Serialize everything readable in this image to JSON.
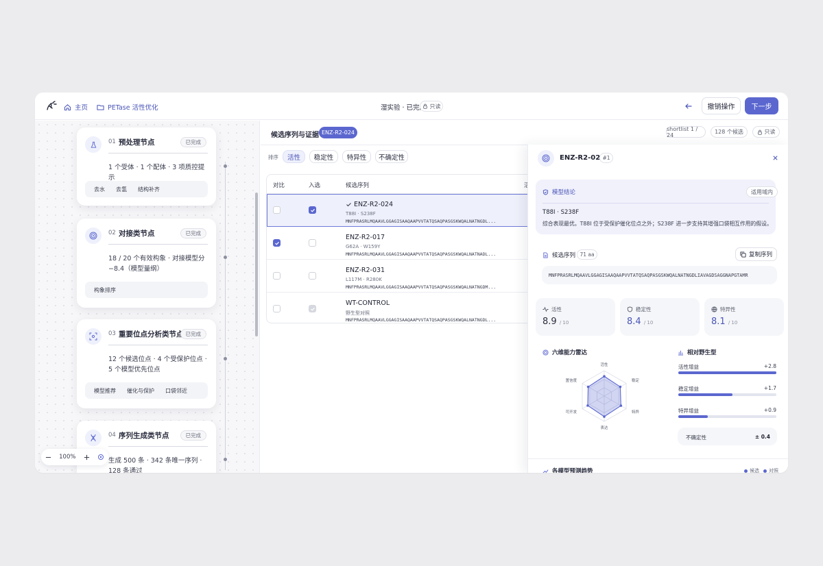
{
  "topbar": {
    "home": "主页",
    "project": "PETase 活性优化",
    "status": "湿实验 · 已完成",
    "readonly": "只读",
    "revoke": "撤销操作",
    "next": "下一步"
  },
  "nodes": [
    {
      "num": "01",
      "title": "预处理节点",
      "badge": "已完成",
      "desc": "1 个受体 · 1 个配体 · 3 项质控提示",
      "tags": [
        "去水",
        "去氢",
        "结构补齐"
      ]
    },
    {
      "num": "02",
      "title": "对接类节点",
      "badge": "已完成",
      "desc": "18 / 20 个有效构象 · 对接模型分 −8.4（模型量纲）",
      "tags": [
        "构象排序"
      ]
    },
    {
      "num": "03",
      "title": "重要位点分析类节点",
      "badge": "已完成",
      "desc": "12 个候选位点 · 4 个受保护位点 · 5 个模型优先位点",
      "tags": [
        "模型推荐",
        "催化与保护",
        "口袋邻近"
      ]
    },
    {
      "num": "04",
      "title": "序列生成类节点",
      "badge": "已完成",
      "desc": "生成 500 条 · 342 条唯一序列 · 128 条通过"
    }
  ],
  "zoom": {
    "level": "100%"
  },
  "middle": {
    "title": "候选序列与证据",
    "selected_chip": "ENZ-R2-024",
    "shortlist": "shortlist 1 / 24",
    "candidates": "128 个候选",
    "readonly": "只读",
    "sort_label": "排序",
    "sort_options": [
      "活性",
      "稳定性",
      "特异性",
      "不确定性"
    ],
    "columns": [
      "对比",
      "入选",
      "候选序列",
      "活"
    ],
    "rows": [
      {
        "id": "ENZ-R2-024",
        "mut": "T88I · S238F",
        "seq": "MNFPRASRLMQAAVLGGAGISAAQAAPVVTATQSAQPASGSKWQALNATNGDL..."
      },
      {
        "id": "ENZ-R2-017",
        "mut": "G62A · W159Y",
        "seq": "MNFPRASRLMQAAVLGGAGISAAQAAPVVTATQSAQPASGSKWQALNATNADL..."
      },
      {
        "id": "ENZ-R2-031",
        "mut": "L117M · R280K",
        "seq": "MNFPRASRLMQAAVLGGAGISAAQAAPVVTATQSAQPASGSKWQALNATNGDM..."
      },
      {
        "id": "WT-CONTROL",
        "mut": "野生型对照",
        "seq": "MNFPRASRLMQAAVLGGAGISAAQAAPVVTATQSAQPASGSKWQALNATNGDL..."
      }
    ]
  },
  "panel": {
    "id": "ENZ-R2-024",
    "rank": "#1",
    "conclusion_title": "模型结论",
    "domain_badge": "适用域内",
    "mutations": "T88I · S238F",
    "conclusion": "综合表现最优。T88I 位于受保护催化位点之外；S238F 进一步支持其增强口袋相互作用的假设。",
    "seq_title": "候选序列",
    "seq_len": "71 aa",
    "copy_label": "复制序列",
    "sequence": "MNFPRASRLMQAAVLGGAGISAAQAAPVVTATQSAQPASGSKWQALNATNGDLIAVAGDSAGGNAPGTAMR",
    "metrics": [
      {
        "label": "活性",
        "value": "8.9",
        "unit": "/ 10",
        "icon": "pulse-icon"
      },
      {
        "label": "稳定性",
        "value": "8.4",
        "unit": "/ 10",
        "icon": "shield-icon"
      },
      {
        "label": "特异性",
        "value": "8.1",
        "unit": "/ 10",
        "icon": "globe-icon"
      }
    ],
    "radar_title": "六维能力雷达",
    "radar_axes": [
      "活性",
      "稳定",
      "特异",
      "表达",
      "可开发",
      "置信度"
    ],
    "radar_values": [
      0.78,
      0.73,
      0.76,
      0.81,
      0.75,
      0.73
    ],
    "wt_title": "相对野生型",
    "gains": [
      {
        "label": "活性增益",
        "value": "+2.8",
        "fill": 1.0
      },
      {
        "label": "稳定增益",
        "value": "+1.7",
        "fill": 0.55
      },
      {
        "label": "特异增益",
        "value": "+0.9",
        "fill": 0.3
      }
    ],
    "uncertainty_label": "不确定性",
    "uncertainty_value": "± 0.4",
    "trend_title": "各模型预测趋势",
    "legend": [
      "候选",
      "对照"
    ]
  },
  "colors": {
    "accent": "#5b67cf",
    "accent_light": "#eef0fb"
  }
}
